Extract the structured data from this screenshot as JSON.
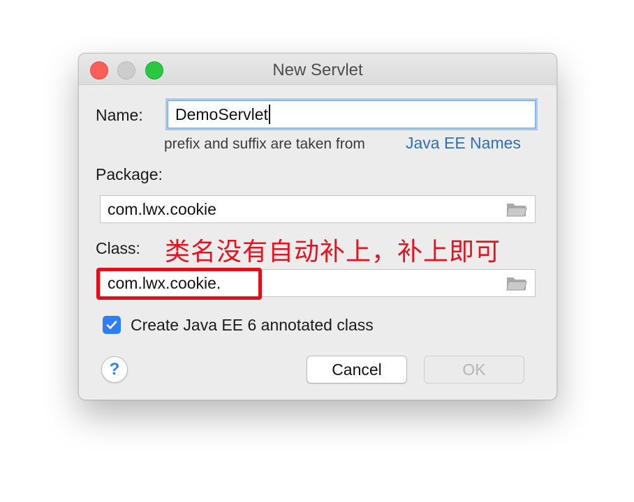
{
  "window": {
    "title": "New Servlet"
  },
  "form": {
    "name_label": "Name:",
    "name_value": "DemoServlet",
    "hint_text": "prefix and suffix are taken from",
    "hint_link": "Java EE Names",
    "package_label": "Package:",
    "package_value": "com.lwx.cookie",
    "class_label": "Class:",
    "class_value": "com.lwx.cookie.",
    "annotation_text": "类名没有自动补上，补上即可",
    "checkbox_label": "Create Java EE 6 annotated class",
    "checkbox_checked": true
  },
  "buttons": {
    "help": "?",
    "cancel": "Cancel",
    "ok": "OK"
  },
  "colors": {
    "accent": "#2f7ef6",
    "annotation": "#e4131f",
    "link": "#2e6fb7"
  },
  "icons": [
    "folder-icon",
    "checkmark-icon",
    "question-icon"
  ]
}
